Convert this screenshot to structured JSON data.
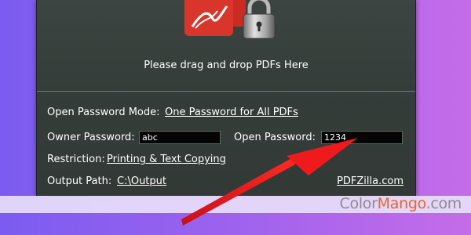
{
  "drop_zone": {
    "message": "Please drag and drop PDFs Here"
  },
  "options": {
    "open_password_mode_label": "Open Password Mode:",
    "open_password_mode_value": "One Password for All PDFs",
    "owner_password_label": "Owner Password:",
    "owner_password_value": "abc",
    "open_password_label": "Open Password:",
    "open_password_value": "1234",
    "restriction_label": "Restriction:",
    "restriction_value": "Printing & Text Copying",
    "output_path_label": "Output Path:",
    "output_path_value": "C:\\Output",
    "website_link": "PDFZilla.com"
  },
  "watermark": {
    "prefix": "Color",
    "brand": "Mango",
    "suffix": ".com"
  },
  "colors": {
    "background_left": "#7b5cf0",
    "background_right": "#c56ce8",
    "panel": "#353d3a",
    "pdf_icon_red": "#d9352b",
    "arrow_red": "#e8161b",
    "watermark_orange": "#e06a30"
  },
  "icons": [
    "pdf-file-icon",
    "padlock-icon",
    "red-arrow-annotation"
  ]
}
